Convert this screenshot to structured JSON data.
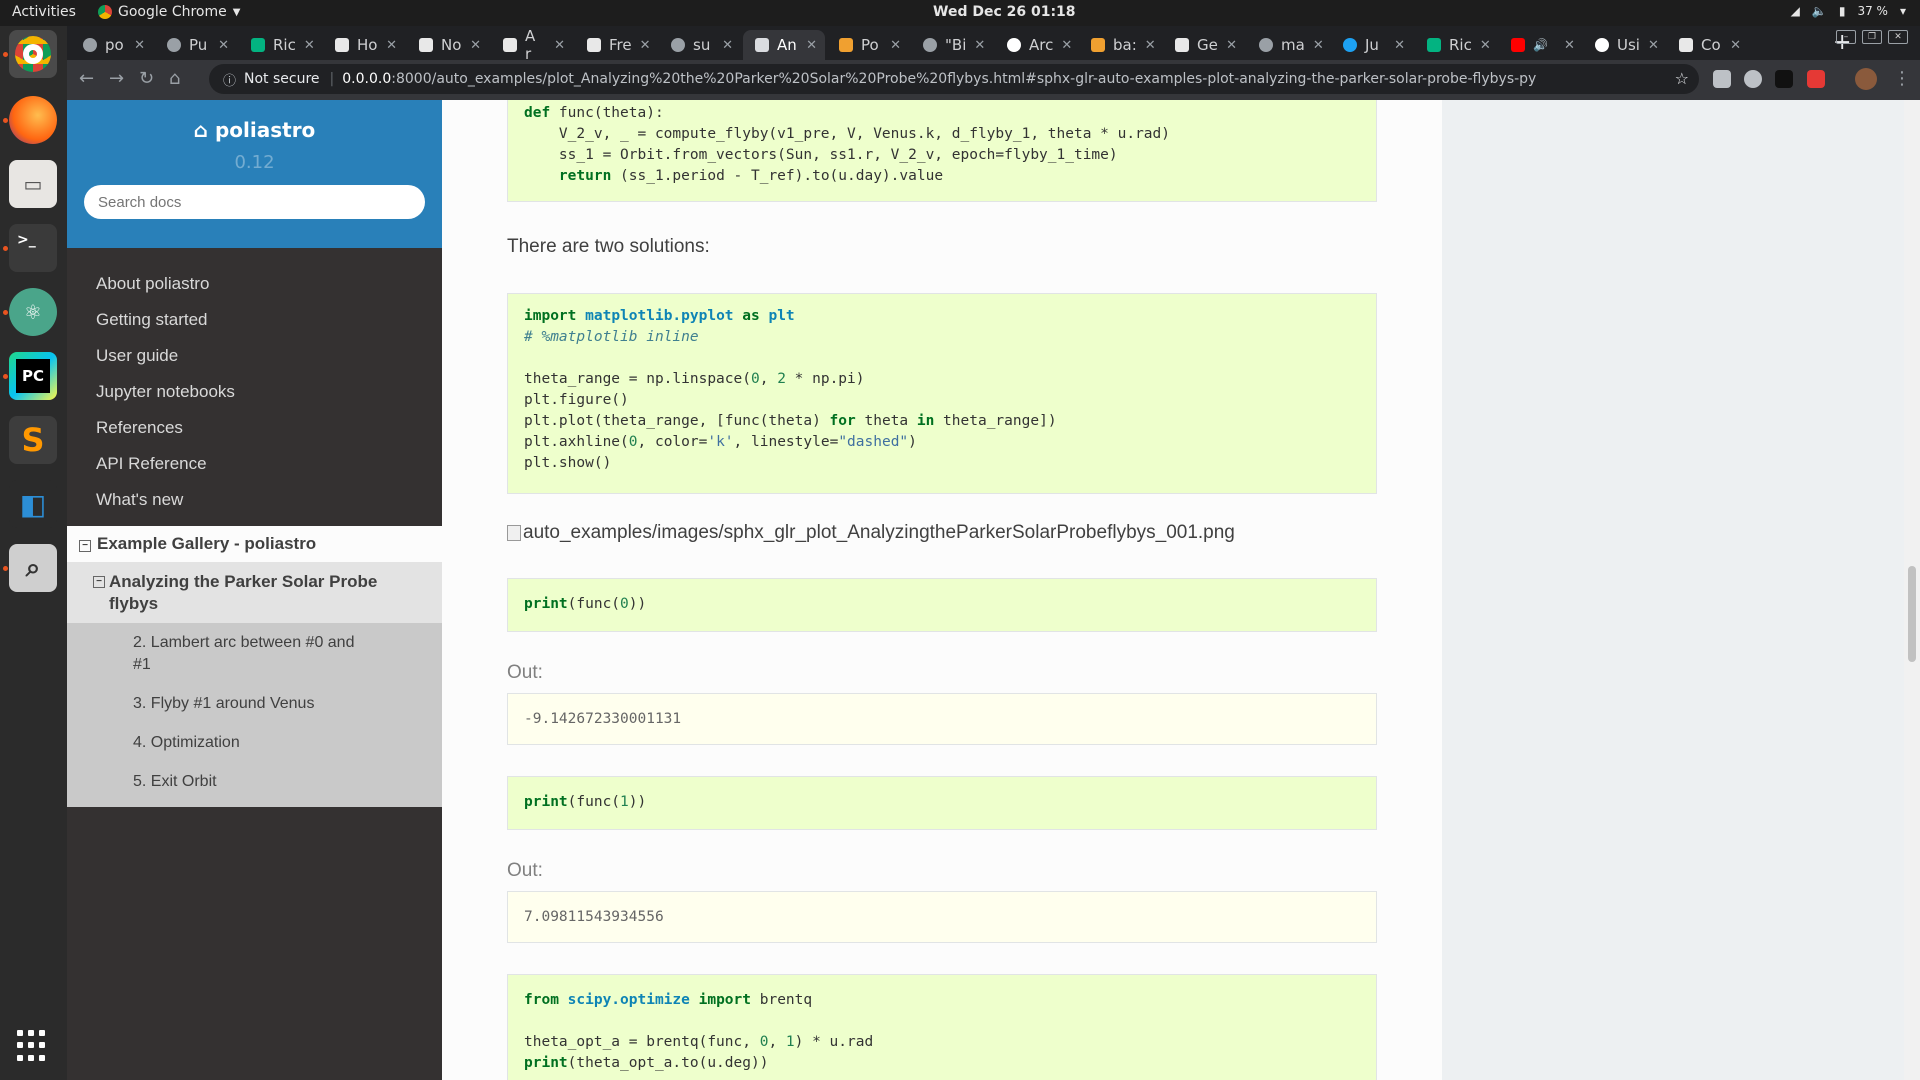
{
  "topbar": {
    "activities": "Activities",
    "app_name": "Google Chrome",
    "clock": "Wed Dec 26  01:18",
    "battery": "37 %"
  },
  "tabs": [
    {
      "label": "po"
    },
    {
      "label": "Pu"
    },
    {
      "label": "Ric"
    },
    {
      "label": "Ho"
    },
    {
      "label": "No"
    },
    {
      "label": "A r"
    },
    {
      "label": "Fre"
    },
    {
      "label": "su"
    },
    {
      "label": "An"
    },
    {
      "label": "Po"
    },
    {
      "label": "\"Bi"
    },
    {
      "label": "Arc"
    },
    {
      "label": "ba:"
    },
    {
      "label": "Ge"
    },
    {
      "label": "ma"
    },
    {
      "label": "Ju"
    },
    {
      "label": "Ric"
    },
    {
      "label": ""
    },
    {
      "label": "Usi"
    },
    {
      "label": "Co"
    }
  ],
  "toolbar": {
    "not_secure": "Not secure",
    "url_host": "0.0.0.0",
    "url_rest": ":8000/auto_examples/plot_Analyzing%20the%20Parker%20Solar%20Probe%20flybys.html#sphx-glr-auto-examples-plot-analyzing-the-parker-solar-probe-flybys-py"
  },
  "sidebar": {
    "brand": "poliastro",
    "version": "0.12",
    "search_placeholder": "Search docs",
    "items": [
      {
        "label": "About poliastro"
      },
      {
        "label": "Getting started"
      },
      {
        "label": "User guide"
      },
      {
        "label": "Jupyter notebooks"
      },
      {
        "label": "References"
      },
      {
        "label": "API Reference"
      },
      {
        "label": "What's new"
      }
    ],
    "current_section": "Example Gallery - poliastro",
    "current_page": "Analyzing the Parker Solar Probe flybys",
    "subitems": [
      {
        "label": "2. Lambert arc between #0 and #1"
      },
      {
        "label": "3. Flyby #1 around Venus"
      },
      {
        "label": "4. Optimization"
      },
      {
        "label": "5. Exit Orbit"
      }
    ]
  },
  "content": {
    "block1": {
      "l1_def": "def",
      "l1_rest": " func(theta):",
      "l2": "    V_2_v, _ = compute_flyby(v1_pre, V, Venus.k, d_flyby_1, theta * u.rad)",
      "l3": "    ss_1 = Orbit.from_vectors(Sun, ss1.r, V_2_v, epoch=flyby_1_time)",
      "l4_indent": "    ",
      "l4_return": "return",
      "l4_rest": " (ss_1.period - T_ref).to(u.day).value"
    },
    "two_solutions": "There are two solutions:",
    "block2": {
      "import": "import",
      "module": "matplotlib.pyplot",
      "as": "as",
      "alias": "plt",
      "comment": "# %matplotlib inline",
      "l3_a": "theta_range = np.linspace(",
      "l3_n0": "0",
      "l3_b": ", ",
      "l3_n2": "2",
      "l3_c": " * np.pi)",
      "l4": "plt.figure()",
      "l5_a": "plt.plot(theta_range, [func(theta) ",
      "l5_for": "for",
      "l5_b": " theta ",
      "l5_in": "in",
      "l5_c": " theta_range])",
      "l6_a": "plt.axhline(",
      "l6_n": "0",
      "l6_b": ", color=",
      "l6_s1": "'k'",
      "l6_c": ", linestyle=",
      "l6_s2": "\"dashed\"",
      "l6_d": ")",
      "l7": "plt.show()"
    },
    "image_alt": "auto_examples/images/sphx_glr_plot_AnalyzingtheParkerSolarProbeflybys_001.png",
    "block3": {
      "print": "print",
      "a": "(func(",
      "n": "0",
      "b": "))"
    },
    "out_label_1": "Out:",
    "out1": "-9.142672330001131",
    "block4": {
      "print": "print",
      "a": "(func(",
      "n": "1",
      "b": "))"
    },
    "out_label_2": "Out:",
    "out2": "7.09811543934556",
    "block5": {
      "from": "from",
      "module": "scipy.optimize",
      "import": "import",
      "name": " brentq",
      "l3_a": "theta_opt_a = brentq(func, ",
      "l3_n0": "0",
      "l3_b": ", ",
      "l3_n1": "1",
      "l3_c": ") * u.rad",
      "l4_print": "print",
      "l4_rest": "(theta_opt_a.to(u.deg))"
    }
  }
}
